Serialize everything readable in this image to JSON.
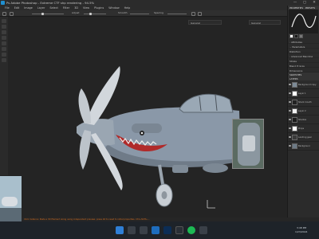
{
  "titlebar": {
    "title": "Ps Adobe Photoshop - Extreme CTF shp rendering - 94.5%",
    "minimize": "—",
    "maximize": "▢",
    "close": "✕"
  },
  "menubar": {
    "items": [
      "File",
      "Edit",
      "Image",
      "Layer",
      "Select",
      "Filter",
      "3D",
      "View",
      "Plugins",
      "Window",
      "Help"
    ]
  },
  "toolbar": {
    "slider1_label": "Adjust",
    "slider2_label": "Smooth",
    "slider3_label": "Spacing"
  },
  "viewport": {
    "dropdown_left": "General",
    "dropdown_right": "General"
  },
  "panels": {
    "properties_header": "PROPERTIES  ·  PRESETS",
    "sections": [
      "Attributes",
      "Parameters",
      "Advanced Blending"
    ],
    "parameters_value": "Distortion",
    "blend_label": "Blend If: Gray",
    "stroke_label": "Stroke",
    "dimensions": "Dimensions",
    "swatches_header": "SWATCHES",
    "layers_header": "LAYERS",
    "layers": [
      "Background copy",
      "Layer 1",
      "Shark mouth",
      "Layer 2",
      "Shadow",
      "Props",
      "Landing gear",
      "Background"
    ]
  },
  "statusbar": {
    "text": "Click Instance: Paste a 3D Element along using independent preview, press Alt to reset to initial properties. Ctrl+Shift+..."
  },
  "taskbar": {
    "time": "3:48 PM",
    "date": "1/23/2024"
  },
  "colors": {
    "accent": "#1f8fd0",
    "status_text": "#d26b1e",
    "plane_body": "#8a98a8",
    "propeller": "#d2d7dc"
  }
}
